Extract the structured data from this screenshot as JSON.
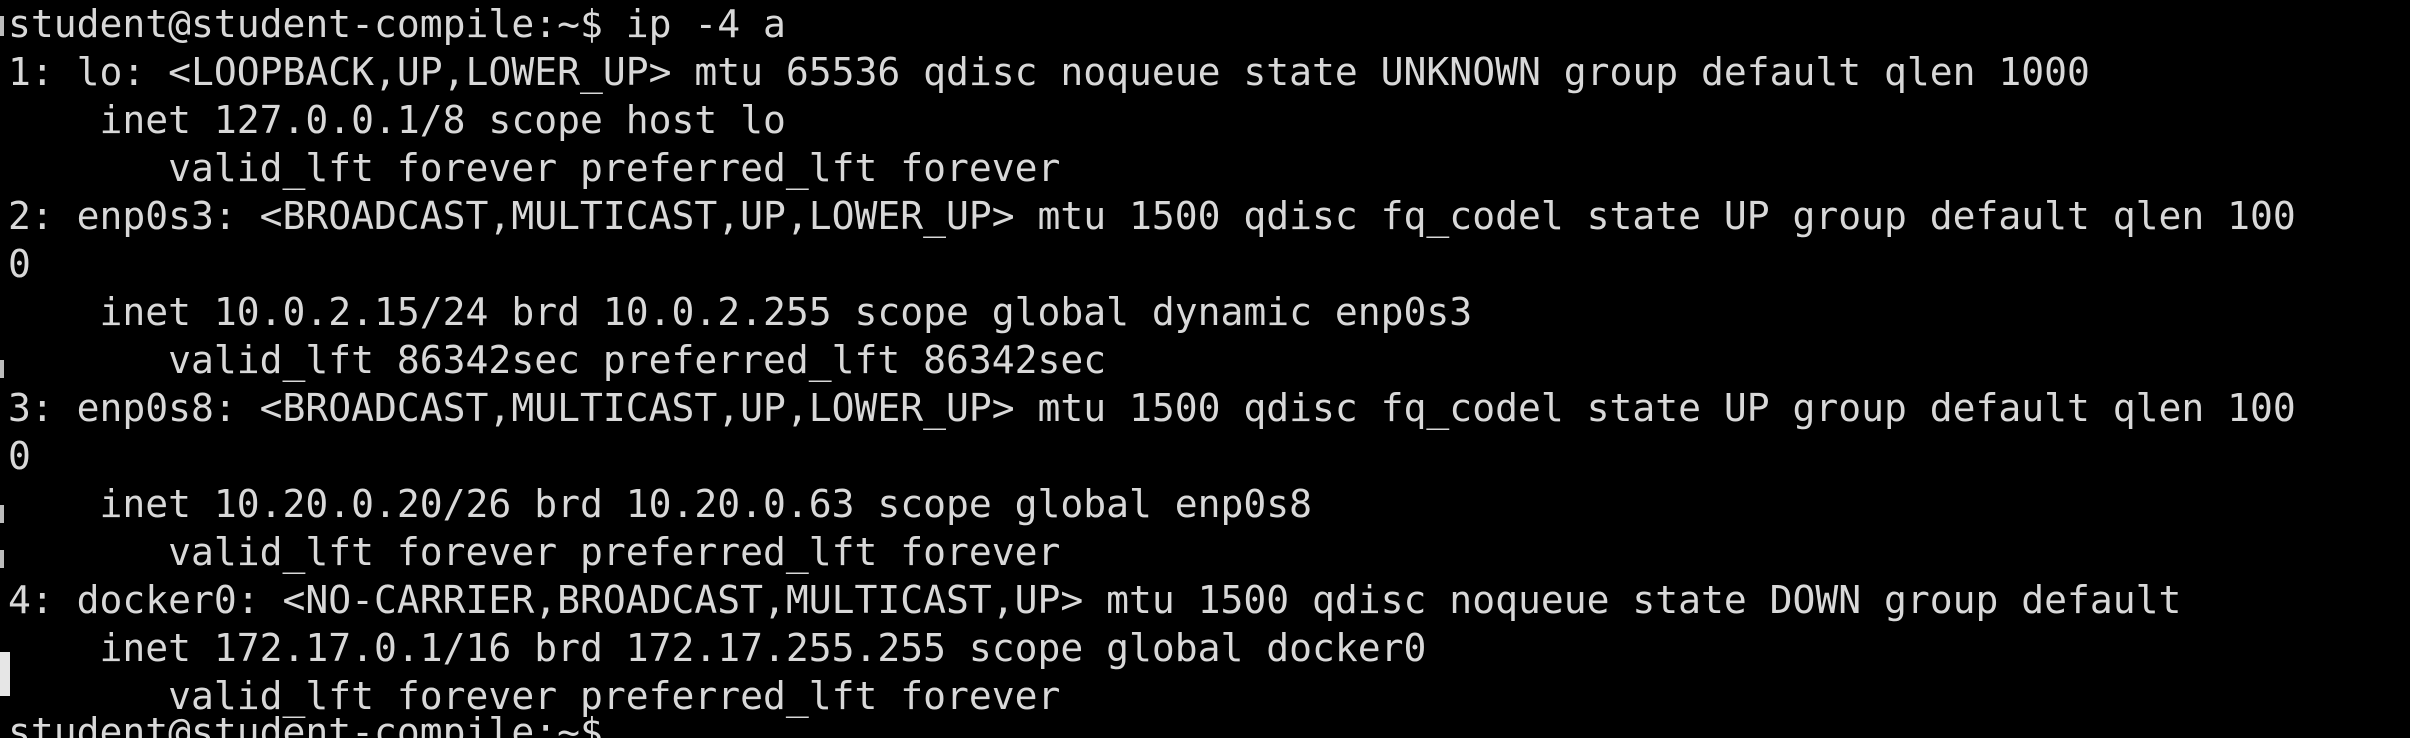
{
  "terminal": {
    "lines": [
      "student@student-compile:~$ ip -4 a",
      "1: lo: <LOOPBACK,UP,LOWER_UP> mtu 65536 qdisc noqueue state UNKNOWN group default qlen 1000",
      "    inet 127.0.0.1/8 scope host lo",
      "       valid_lft forever preferred_lft forever",
      "2: enp0s3: <BROADCAST,MULTICAST,UP,LOWER_UP> mtu 1500 qdisc fq_codel state UP group default qlen 100",
      "0",
      "    inet 10.0.2.15/24 brd 10.0.2.255 scope global dynamic enp0s3",
      "       valid_lft 86342sec preferred_lft 86342sec",
      "3: enp0s8: <BROADCAST,MULTICAST,UP,LOWER_UP> mtu 1500 qdisc fq_codel state UP group default qlen 100",
      "0",
      "    inet 10.20.0.20/26 brd 10.20.0.63 scope global enp0s8",
      "       valid_lft forever preferred_lft forever",
      "4: docker0: <NO-CARRIER,BROADCAST,MULTICAST,UP> mtu 1500 qdisc noqueue state DOWN group default",
      "    inet 172.17.0.1/16 brd 172.17.255.255 scope global docker0",
      "       valid_lft forever preferred_lft forever"
    ],
    "partial_prompt": "student@student-compile:~$"
  }
}
